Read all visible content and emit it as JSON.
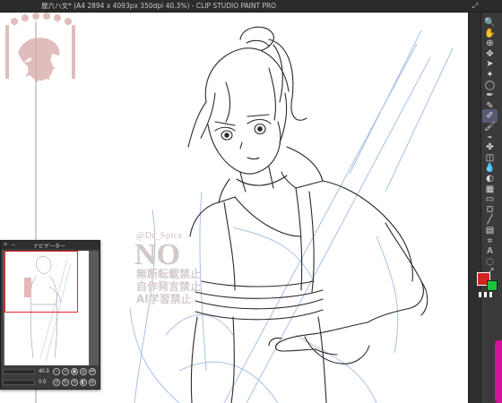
{
  "window": {
    "title": "屋六ハ文* (A4 2894 x 4093px 350dpi 40.3%) - CLIP STUDIO PAINT PRO",
    "expand_icon": "expand-arrows-icon"
  },
  "watermark": {
    "handle": "@Dr_Spica",
    "no_text": "NO",
    "lines": [
      "無断転載禁止",
      "自作発言禁止",
      "AI学習禁止"
    ]
  },
  "toolbar": {
    "tools": [
      {
        "name": "zoom-icon",
        "glyph": "🔍"
      },
      {
        "name": "hand-icon",
        "glyph": "✋"
      },
      {
        "name": "zoom-in-icon",
        "glyph": "⊕"
      },
      {
        "name": "move-icon",
        "glyph": "✥"
      },
      {
        "name": "pointer-icon",
        "glyph": "➤"
      },
      {
        "name": "magic-wand-icon",
        "glyph": "✦"
      },
      {
        "name": "lasso-icon",
        "glyph": "◯"
      },
      {
        "name": "eyedropper-icon",
        "glyph": "✒"
      },
      {
        "name": "pen-icon",
        "glyph": "✎"
      },
      {
        "name": "pencil-icon",
        "glyph": "✐"
      },
      {
        "name": "brush-icon",
        "glyph": "🖌"
      },
      {
        "name": "airbrush-icon",
        "glyph": "⌁"
      },
      {
        "name": "decoration-icon",
        "glyph": "✤"
      },
      {
        "name": "eraser-icon",
        "glyph": "◫"
      },
      {
        "name": "blend-icon",
        "glyph": "💧"
      },
      {
        "name": "fill-icon",
        "glyph": "◐"
      },
      {
        "name": "gradient-icon",
        "glyph": "▦"
      },
      {
        "name": "figure-icon",
        "glyph": "▭"
      },
      {
        "name": "bucket-icon",
        "glyph": "⛋"
      },
      {
        "name": "line-icon",
        "glyph": "╱"
      },
      {
        "name": "frame-icon",
        "glyph": "▤"
      },
      {
        "name": "ruler-icon",
        "glyph": "⌗"
      },
      {
        "name": "text-icon",
        "glyph": "A"
      },
      {
        "name": "balloon-icon",
        "glyph": "◌"
      },
      {
        "name": "correct-line-icon",
        "glyph": "⤢"
      }
    ],
    "active_index": 9,
    "main_color": "#d3241f",
    "sub_color": "#19c23a"
  },
  "navigator": {
    "title": "ナビゲーター",
    "zoom": "40.3",
    "angle": "0.0",
    "close_glyph": "×",
    "min_glyph": "–"
  }
}
